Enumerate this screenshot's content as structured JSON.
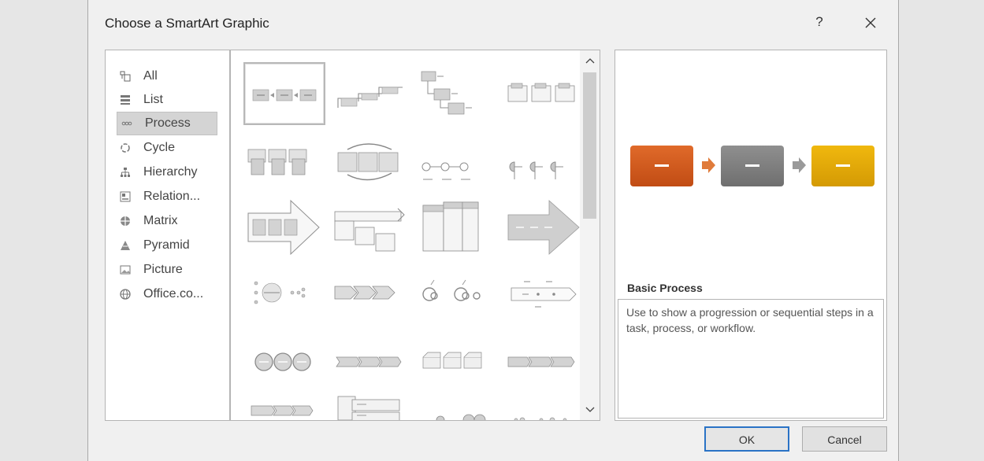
{
  "dialog": {
    "title": "Choose a SmartArt Graphic",
    "help_label": "?",
    "close_icon": "close-icon"
  },
  "categories": [
    {
      "label": "All",
      "icon": "all-icon"
    },
    {
      "label": "List",
      "icon": "list-icon"
    },
    {
      "label": "Process",
      "icon": "process-icon",
      "selected": true
    },
    {
      "label": "Cycle",
      "icon": "cycle-icon"
    },
    {
      "label": "Hierarchy",
      "icon": "hierarchy-icon"
    },
    {
      "label": "Relation...",
      "icon": "relationship-icon"
    },
    {
      "label": "Matrix",
      "icon": "matrix-icon"
    },
    {
      "label": "Pyramid",
      "icon": "pyramid-icon"
    },
    {
      "label": "Picture",
      "icon": "picture-icon"
    },
    {
      "label": "Office.co...",
      "icon": "office-com-icon"
    }
  ],
  "preview": {
    "title": "Basic Process",
    "description": "Use to show a progression or sequential steps in a task, process, or workflow.",
    "colors": {
      "box1": "#d2561c",
      "box2": "#7f7f7f",
      "box3": "#e3a808",
      "arrow1": "#e07b3a",
      "arrow2": "#9a9a9a"
    }
  },
  "buttons": {
    "ok": "OK",
    "cancel": "Cancel"
  }
}
